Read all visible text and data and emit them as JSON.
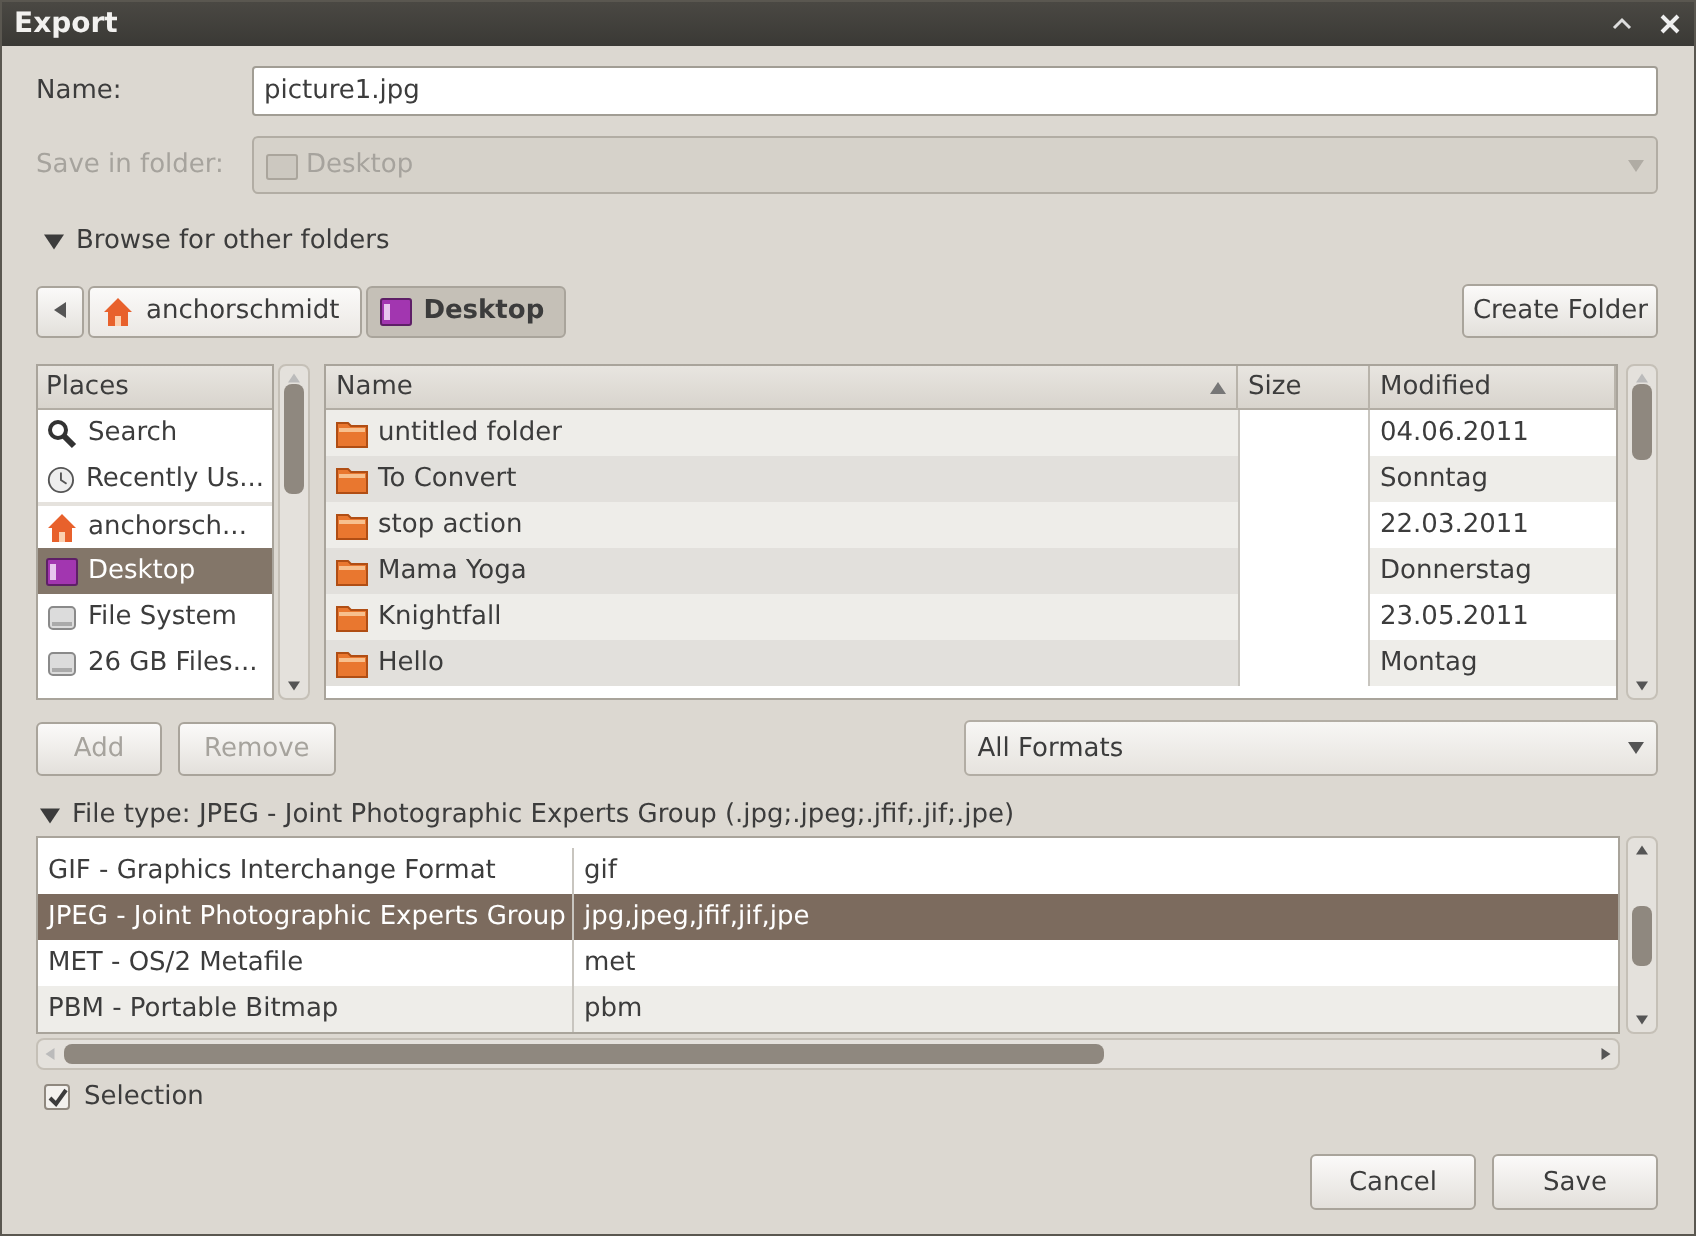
{
  "window": {
    "title": "Export"
  },
  "name_field": {
    "label": "Name:",
    "value": "picture1.jpg"
  },
  "save_in_folder": {
    "label": "Save in folder:",
    "value": "Desktop",
    "disabled": true
  },
  "browse": {
    "label": "Browse for other folders",
    "expanded": true
  },
  "path_bar": [
    {
      "label": "anchorschmidt",
      "kind": "home",
      "selected": false
    },
    {
      "label": "Desktop",
      "kind": "desktop",
      "selected": true
    }
  ],
  "create_folder": "Create Folder",
  "places": {
    "heading": "Places",
    "items": [
      {
        "label": "Search",
        "kind": "search",
        "selected": false,
        "divider_before": false
      },
      {
        "label": "Recently Us...",
        "kind": "recent",
        "selected": false,
        "divider_before": false
      },
      {
        "label": "anchorsch...",
        "kind": "home",
        "selected": false,
        "divider_before": true
      },
      {
        "label": "Desktop",
        "kind": "desktop",
        "selected": true,
        "divider_before": false
      },
      {
        "label": "File System",
        "kind": "drive",
        "selected": false,
        "divider_before": false
      },
      {
        "label": "26 GB Files...",
        "kind": "drive",
        "selected": false,
        "divider_before": false
      }
    ]
  },
  "place_buttons": [
    {
      "label": "Add",
      "disabled": true
    },
    {
      "label": "Remove",
      "disabled": true
    }
  ],
  "files": {
    "columns": [
      {
        "label": "Name",
        "sorted": true
      },
      {
        "label": "Size",
        "sorted": false
      },
      {
        "label": "Modified",
        "sorted": false
      }
    ],
    "rows": [
      {
        "name": "untitled folder",
        "modified": "04.06.2011",
        "selected": false
      },
      {
        "name": "To Convert",
        "modified": "Sonntag",
        "selected": false
      },
      {
        "name": "stop action",
        "modified": "22.03.2011",
        "selected": false
      },
      {
        "name": "Mama Yoga",
        "modified": "Donnerstag",
        "selected": false
      },
      {
        "name": "Knightfall",
        "modified": "23.05.2011",
        "selected": false
      },
      {
        "name": "Hello",
        "modified": "Montag",
        "selected": false
      }
    ]
  },
  "filter": {
    "value": "All Formats"
  },
  "file_type": {
    "label": "File type: JPEG - Joint Photographic Experts Group (.jpg;.jpeg;.jfif;.jif;.jpe)",
    "expanded": true,
    "rows": [
      {
        "name": "GIF - Graphics Interchange Format",
        "extensions": "gif",
        "selected": false
      },
      {
        "name": "JPEG - Joint Photographic Experts Group",
        "extensions": "jpg,jpeg,jfif,jif,jpe",
        "selected": true
      },
      {
        "name": "MET - OS/2 Metafile",
        "extensions": "met",
        "selected": false
      },
      {
        "name": "PBM - Portable Bitmap",
        "extensions": "pbm",
        "selected": false
      }
    ]
  },
  "selection": {
    "label": "Selection",
    "checked": true
  },
  "buttons": [
    {
      "label": "Cancel"
    },
    {
      "label": "Save"
    }
  ]
}
